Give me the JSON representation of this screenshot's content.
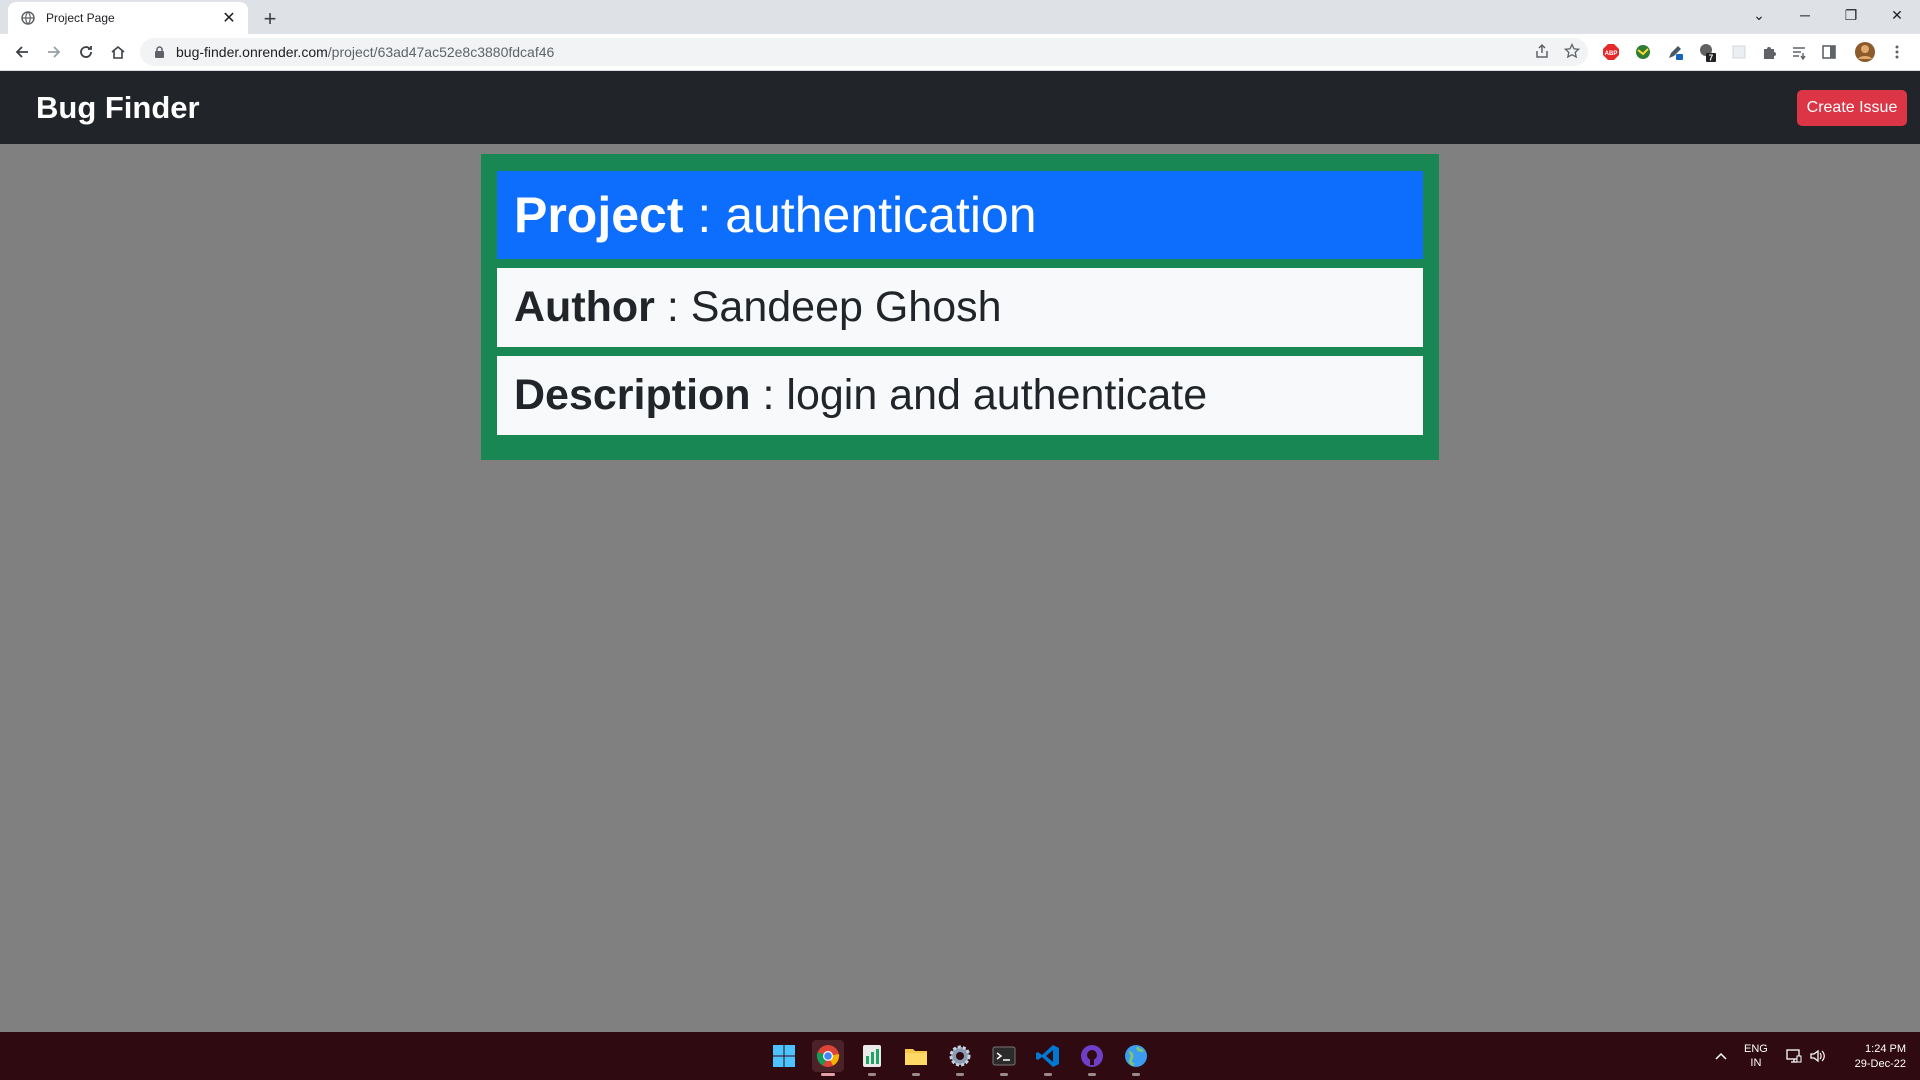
{
  "browser": {
    "tab_title": "Project Page",
    "url_host": "bug-finder.onrender.com",
    "url_path": "/project/63ad47ac52e8c3880fdcaf46",
    "extensions": [
      "abp-icon",
      "globe-extension-icon",
      "pen-extension-icon",
      "lock-extension-icon",
      "blank-extension-icon",
      "puzzle-icon",
      "reading-list-icon",
      "side-panel-icon",
      "profile-avatar"
    ],
    "extension_badge": "7"
  },
  "navbar": {
    "brand": "Bug Finder",
    "create_label": "Create Issue"
  },
  "project": {
    "project_label": "Project",
    "project_value": " : authentication",
    "author_label": "Author",
    "author_value": " : Sandeep Ghosh",
    "description_label": "Description",
    "description_value": " : login and authenticate"
  },
  "colors": {
    "navbar": "#212529",
    "card_border": "#198754",
    "project_row": "#0d6efd",
    "button": "#dc3545",
    "page_bg": "#808080"
  },
  "taskbar": {
    "apps": [
      "windows-start-icon",
      "chrome-icon",
      "spreadsheet-icon",
      "file-explorer-icon",
      "settings-icon",
      "terminal-icon",
      "vscode-icon",
      "github-desktop-icon",
      "globe-app-icon"
    ],
    "lang_line1": "ENG",
    "lang_line2": "IN",
    "time": "1:24 PM",
    "date": "29-Dec-22"
  }
}
